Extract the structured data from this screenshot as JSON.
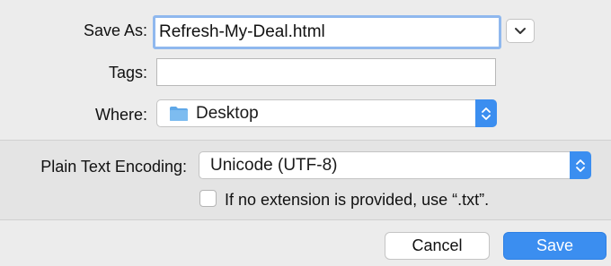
{
  "dialog": {
    "save_as_label": "Save As:",
    "save_as_value": "Refresh-My-Deal.html",
    "tags_label": "Tags:",
    "tags_value": "",
    "where_label": "Where:",
    "where_value": "Desktop",
    "encoding_label": "Plain Text Encoding:",
    "encoding_value": "Unicode (UTF-8)",
    "extension_checkbox_label": "If no extension is provided, use “.txt”.",
    "extension_checkbox_checked": false,
    "cancel_label": "Cancel",
    "save_label": "Save"
  },
  "icons": {
    "expand": "chevron-down-icon",
    "where": "folder-icon",
    "stepper": "up-down-chevron-icon"
  },
  "colors": {
    "accent": "#3b8ef0",
    "focus_ring": "#8fb8ee",
    "folder": "#5fa8e8"
  }
}
